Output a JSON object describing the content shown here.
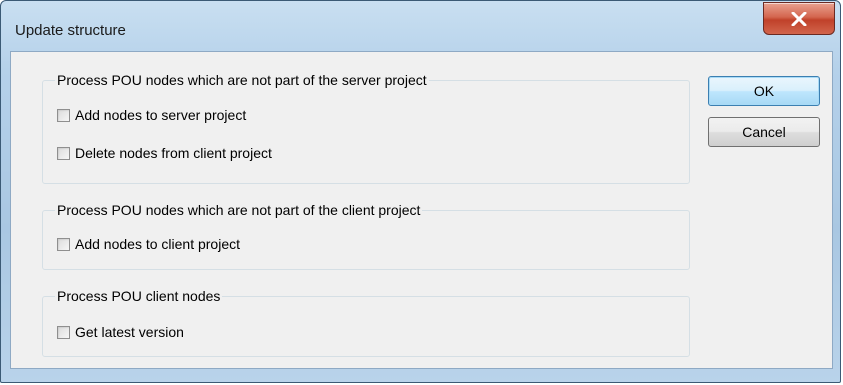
{
  "window": {
    "title": "Update structure"
  },
  "groups": [
    {
      "legend": "Process POU nodes which are not part of the server project",
      "options": [
        {
          "label": "Add nodes to server project",
          "checked": false
        },
        {
          "label": "Delete nodes from client project",
          "checked": false
        }
      ]
    },
    {
      "legend": "Process POU nodes which are not part of the client project",
      "options": [
        {
          "label": "Add nodes to client project",
          "checked": false
        }
      ]
    },
    {
      "legend": "Process POU client nodes",
      "options": [
        {
          "label": "Get latest version",
          "checked": false
        }
      ]
    }
  ],
  "buttons": {
    "ok": "OK",
    "cancel": "Cancel"
  },
  "icons": {
    "close": "close-x-icon"
  },
  "colors": {
    "frame": "#b5d1ea",
    "close_button": "#c0412a",
    "default_button_border": "#3c7fb1"
  }
}
